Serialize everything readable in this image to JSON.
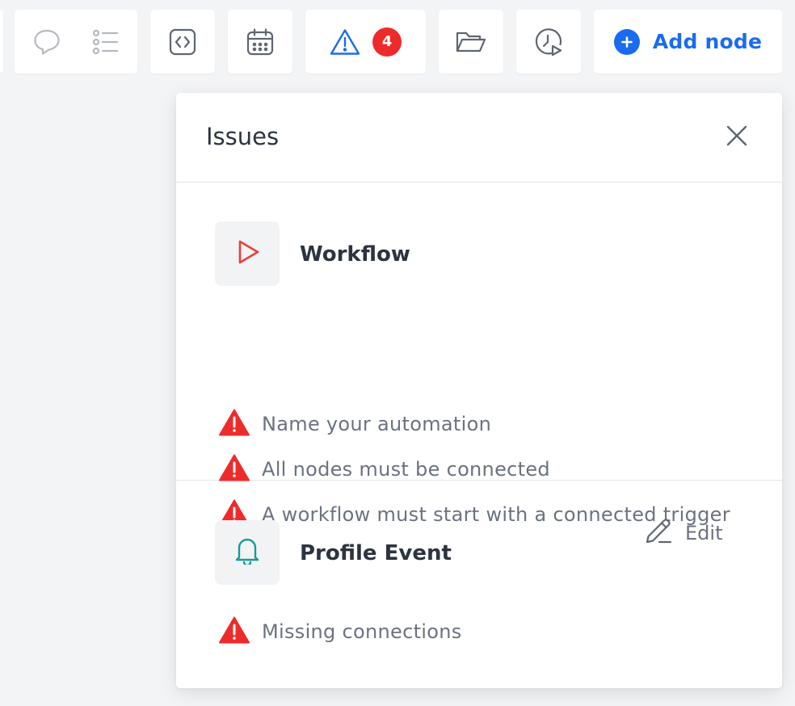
{
  "toolbar": {
    "badge_count": "4",
    "add_node_label": "Add node"
  },
  "issues_panel": {
    "title": "Issues",
    "groups": [
      {
        "title": "Workflow",
        "icon": "play-icon",
        "icon_color": "#e8403a",
        "issues": [
          "Name your automation",
          "All nodes must be connected",
          "A workflow must start with a connected trigger"
        ]
      },
      {
        "title": "Profile Event",
        "icon": "bell-icon",
        "icon_color": "#149c98",
        "edit_label": "Edit",
        "issues": [
          "Missing connections"
        ]
      }
    ]
  },
  "colors": {
    "accent": "#1a6bf0",
    "error": "#ee2b2b",
    "background": "#f3f4f6"
  }
}
